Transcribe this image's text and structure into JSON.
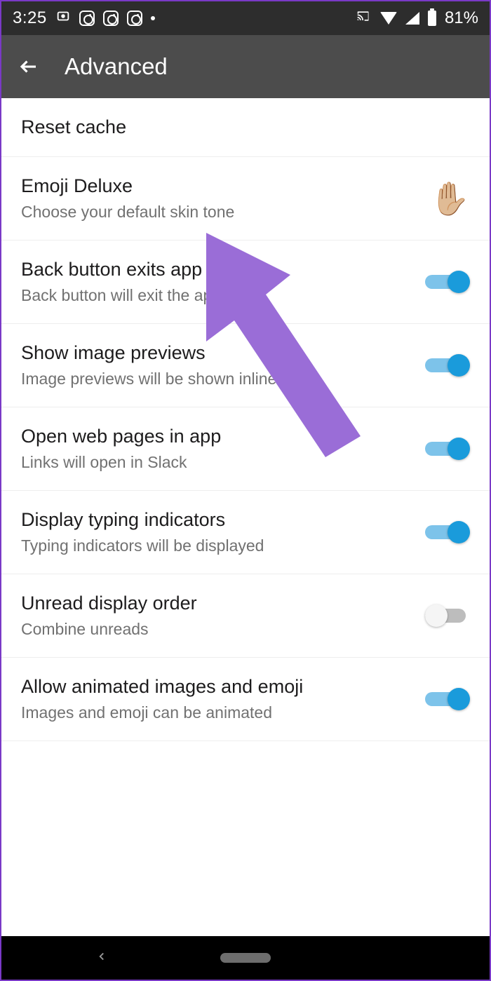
{
  "statusbar": {
    "time": "3:25",
    "battery": "81%"
  },
  "appbar": {
    "title": "Advanced"
  },
  "settings": [
    {
      "title": "Reset cache",
      "sub": null,
      "type": "plain"
    },
    {
      "title": "Emoji Deluxe",
      "sub": "Choose your default skin tone",
      "type": "emoji",
      "emoji": "✋🏼"
    },
    {
      "title": "Back button exits app",
      "sub": "Back button will exit the app",
      "type": "toggle",
      "on": true
    },
    {
      "title": "Show image previews",
      "sub": "Image previews will be shown inline",
      "type": "toggle",
      "on": true
    },
    {
      "title": "Open web pages in app",
      "sub": "Links will open in Slack",
      "type": "toggle",
      "on": true
    },
    {
      "title": "Display typing indicators",
      "sub": "Typing indicators will be displayed",
      "type": "toggle",
      "on": true
    },
    {
      "title": "Unread display order",
      "sub": "Combine unreads",
      "type": "toggle",
      "on": false
    },
    {
      "title": "Allow animated images and emoji",
      "sub": "Images and emoji can be animated",
      "type": "toggle",
      "on": true
    }
  ]
}
